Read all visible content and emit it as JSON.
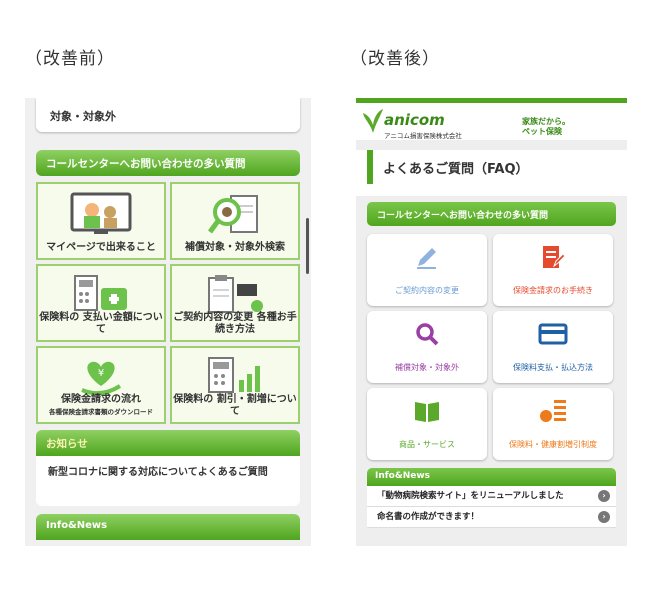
{
  "captions": {
    "before": "（改善前）",
    "after": "（改善後）"
  },
  "before": {
    "top_item": "対象・対象外",
    "section_title": "コールセンターへお問い合わせの多い質問",
    "tiles": [
      {
        "label": "マイページで出来ること",
        "sub": "",
        "icon": "mypage-icon"
      },
      {
        "label": "補償対象・対象外検索",
        "sub": "",
        "icon": "dog-search-icon"
      },
      {
        "label": "保険料の 支払い金額について",
        "sub": "",
        "icon": "calculator-wallet-icon"
      },
      {
        "label": "ご契約内容の変更 各種お手続き方法",
        "sub": "",
        "icon": "clipboard-dog-icon"
      },
      {
        "label": "保険金請求の流れ",
        "sub": "各種保険金請求書類のダウンロード",
        "icon": "yen-hand-icon"
      },
      {
        "label": "保険料の 割引・割増について",
        "sub": "",
        "icon": "calculator-chart-icon"
      }
    ],
    "notice_title": "お知らせ",
    "notice_text": "新型コロナに関する対応についてよくあるご質問",
    "info_title": "Info&News"
  },
  "after": {
    "logo": "anicom",
    "logo_sub": "アニコム損害保険株式会社",
    "tagline_1": "家族だから。",
    "tagline_2": "ペット保険",
    "page_title": "よくあるご質問（FAQ）",
    "section_title": "コールセンターへお問い合わせの多い質問",
    "tiles": [
      {
        "label": "ご契約内容の変更",
        "color": "#6b9bd1",
        "icon": "pencil-icon"
      },
      {
        "label": "保険金請求のお手続き",
        "color": "#e64a2e",
        "icon": "document-edit-icon"
      },
      {
        "label": "補償対象・対象外",
        "color": "#9b3fa6",
        "icon": "magnifier-icon"
      },
      {
        "label": "保険料支払・払込方法",
        "color": "#1f5fa6",
        "icon": "credit-card-icon"
      },
      {
        "label": "商品・サービス",
        "color": "#5aa92a",
        "icon": "book-icon"
      },
      {
        "label": "保険料・健康割増引制度",
        "color": "#ef7a1a",
        "icon": "bars-circle-icon"
      }
    ],
    "info_title": "Info&News",
    "news": [
      "「動物病院検索サイト」をリニューアルしました",
      "命名書の作成ができます！"
    ]
  }
}
